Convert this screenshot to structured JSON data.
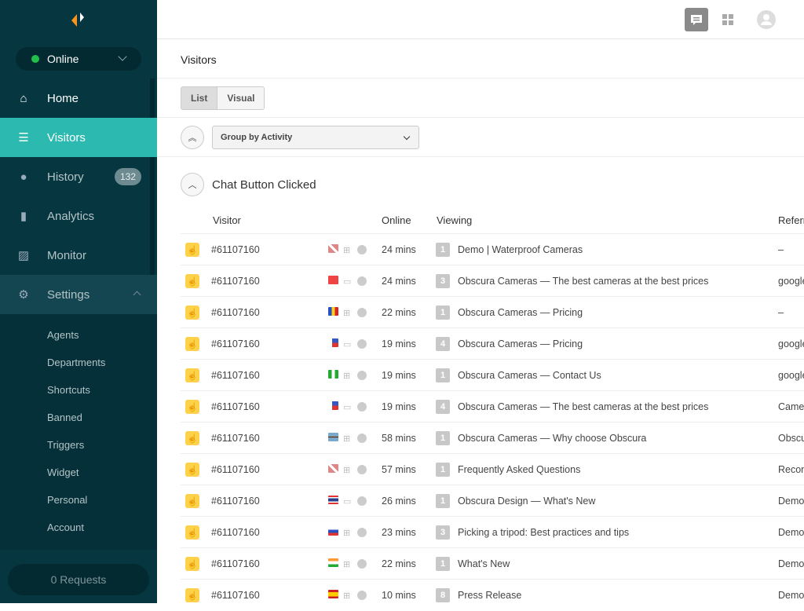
{
  "sidebar": {
    "status": "Online",
    "items": [
      {
        "label": "Home",
        "icon": "home-icon"
      },
      {
        "label": "Visitors",
        "icon": "visitors-icon"
      },
      {
        "label": "History",
        "icon": "clock-icon",
        "badge": "132"
      },
      {
        "label": "Analytics",
        "icon": "bar-chart-icon"
      },
      {
        "label": "Monitor",
        "icon": "monitor-icon"
      },
      {
        "label": "Settings",
        "icon": "gear-icon"
      }
    ],
    "settings_sub": [
      "Agents",
      "Departments",
      "Shortcuts",
      "Banned",
      "Triggers",
      "Widget",
      "Personal",
      "Account"
    ],
    "requests": "0 Requests"
  },
  "page": {
    "title": "Visitors",
    "view_tabs": [
      "List",
      "Visual"
    ],
    "group_select": "Group by Activity",
    "group_title": "Chat Button Clicked"
  },
  "table": {
    "headers": [
      "Visitor",
      "Online",
      "Viewing",
      "Referr"
    ],
    "rows": [
      {
        "id": "#61107160",
        "flag": "uk",
        "os": "windows",
        "online": "24 mins",
        "pages": "1",
        "viewing": "Demo | Waterproof Cameras",
        "ref": "–"
      },
      {
        "id": "#61107160",
        "flag": "turkey",
        "os": "desktop",
        "online": "24 mins",
        "pages": "3",
        "viewing": "Obscura Cameras — The best cameras at the best prices",
        "ref": "google"
      },
      {
        "id": "#61107160",
        "flag": "romania",
        "os": "windows",
        "online": "22 mins",
        "pages": "1",
        "viewing": "Obscura Cameras — Pricing",
        "ref": "–"
      },
      {
        "id": "#61107160",
        "flag": "philippines",
        "os": "desktop",
        "online": "19 mins",
        "pages": "4",
        "viewing": "Obscura Cameras — Pricing",
        "ref": "google"
      },
      {
        "id": "#61107160",
        "flag": "nigeria",
        "os": "windows",
        "online": "19 mins",
        "pages": "1",
        "viewing": "Obscura Cameras — Contact Us",
        "ref": "google"
      },
      {
        "id": "#61107160",
        "flag": "philippines",
        "os": "desktop",
        "online": "19 mins",
        "pages": "4",
        "viewing": "Obscura Cameras — The best cameras at the best prices",
        "ref": "Camer"
      },
      {
        "id": "#61107160",
        "flag": "botswana",
        "os": "windows",
        "online": "58 mins",
        "pages": "1",
        "viewing": "Obscura Cameras — Why choose Obscura",
        "ref": "Obscu"
      },
      {
        "id": "#61107160",
        "flag": "uk",
        "os": "windows",
        "online": "57 mins",
        "pages": "1",
        "viewing": "Frequently Asked Questions",
        "ref": "Recon"
      },
      {
        "id": "#61107160",
        "flag": "thailand",
        "os": "desktop",
        "online": "26 mins",
        "pages": "1",
        "viewing": "Obscura Design — What's New",
        "ref": "Demo"
      },
      {
        "id": "#61107160",
        "flag": "slovakia",
        "os": "windows",
        "online": "23 mins",
        "pages": "3",
        "viewing": "Picking a tripod: Best practices and tips",
        "ref": "Demo"
      },
      {
        "id": "#61107160",
        "flag": "india",
        "os": "windows",
        "online": "22 mins",
        "pages": "1",
        "viewing": "What's New",
        "ref": "Demo"
      },
      {
        "id": "#61107160",
        "flag": "spain",
        "os": "windows",
        "online": "10 mins",
        "pages": "8",
        "viewing": "Press Release",
        "ref": "Demo"
      }
    ]
  },
  "colors": {
    "sidebar": "#063740",
    "accent": "#2bb9b0",
    "online": "#1fc14a",
    "hand": "#fdd24a"
  }
}
